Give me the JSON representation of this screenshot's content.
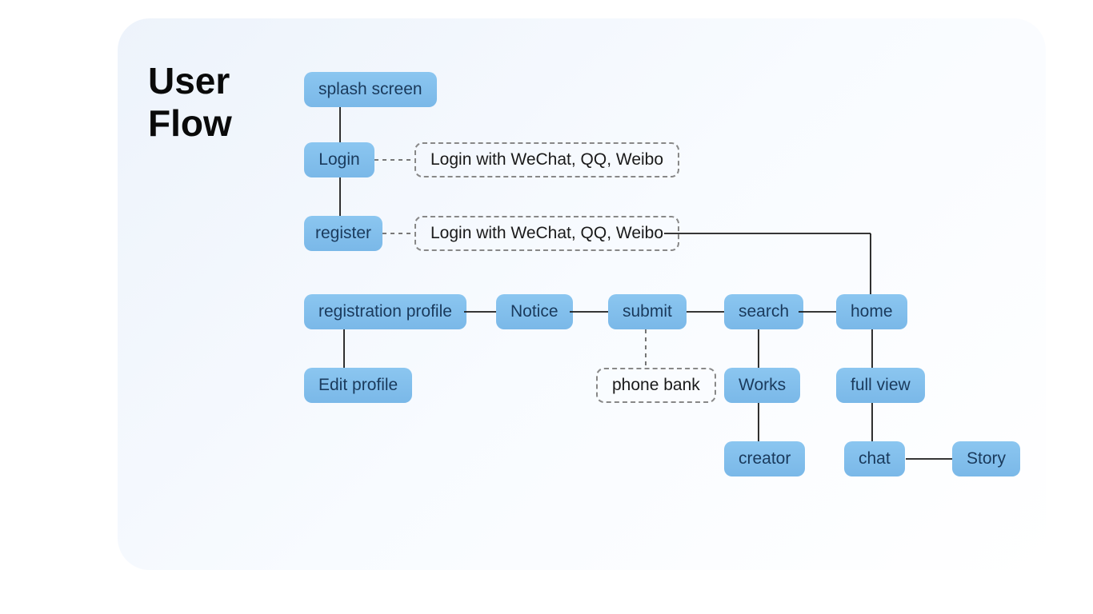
{
  "title_line1": "User",
  "title_line2": "Flow",
  "nodes": {
    "splash": "splash screen",
    "login": "Login",
    "register": "register",
    "login_note": "Login with WeChat, QQ, Weibo",
    "register_note": "Login with WeChat, QQ, Weibo",
    "reg_profile": "registration profile",
    "edit_profile": "Edit profile",
    "notice": "Notice",
    "submit": "submit",
    "phone_bank": "phone bank",
    "search": "search",
    "works": "Works",
    "creator": "creator",
    "home": "home",
    "full_view": "full view",
    "chat": "chat",
    "story": "Story"
  },
  "chart_data": {
    "type": "flow",
    "title": "User Flow",
    "nodes": [
      {
        "id": "splash",
        "label": "splash screen",
        "kind": "screen"
      },
      {
        "id": "login",
        "label": "Login",
        "kind": "screen"
      },
      {
        "id": "register",
        "label": "register",
        "kind": "screen"
      },
      {
        "id": "login_note",
        "label": "Login with WeChat, QQ, Weibo",
        "kind": "annotation"
      },
      {
        "id": "register_note",
        "label": "Login with WeChat, QQ, Weibo",
        "kind": "annotation"
      },
      {
        "id": "reg_profile",
        "label": "registration profile",
        "kind": "screen"
      },
      {
        "id": "edit_profile",
        "label": "Edit profile",
        "kind": "screen"
      },
      {
        "id": "notice",
        "label": "Notice",
        "kind": "screen"
      },
      {
        "id": "submit",
        "label": "submit",
        "kind": "screen"
      },
      {
        "id": "phone_bank",
        "label": "phone bank",
        "kind": "annotation"
      },
      {
        "id": "search",
        "label": "search",
        "kind": "screen"
      },
      {
        "id": "works",
        "label": "Works",
        "kind": "screen"
      },
      {
        "id": "creator",
        "label": "creator",
        "kind": "screen"
      },
      {
        "id": "home",
        "label": "home",
        "kind": "screen"
      },
      {
        "id": "full_view",
        "label": "full view",
        "kind": "screen"
      },
      {
        "id": "chat",
        "label": "chat",
        "kind": "screen"
      },
      {
        "id": "story",
        "label": "Story",
        "kind": "screen"
      }
    ],
    "edges": [
      {
        "from": "splash",
        "to": "login",
        "style": "solid"
      },
      {
        "from": "login",
        "to": "register",
        "style": "solid"
      },
      {
        "from": "login",
        "to": "login_note",
        "style": "dashed"
      },
      {
        "from": "register",
        "to": "register_note",
        "style": "dashed"
      },
      {
        "from": "register_note",
        "to": "home",
        "style": "solid"
      },
      {
        "from": "reg_profile",
        "to": "edit_profile",
        "style": "solid"
      },
      {
        "from": "reg_profile",
        "to": "notice",
        "style": "solid"
      },
      {
        "from": "notice",
        "to": "submit",
        "style": "solid"
      },
      {
        "from": "submit",
        "to": "phone_bank",
        "style": "dashed"
      },
      {
        "from": "submit",
        "to": "search",
        "style": "solid"
      },
      {
        "from": "search",
        "to": "works",
        "style": "solid"
      },
      {
        "from": "works",
        "to": "creator",
        "style": "solid"
      },
      {
        "from": "search",
        "to": "home",
        "style": "solid"
      },
      {
        "from": "home",
        "to": "full_view",
        "style": "solid"
      },
      {
        "from": "full_view",
        "to": "chat",
        "style": "solid"
      },
      {
        "from": "chat",
        "to": "story",
        "style": "solid"
      }
    ]
  }
}
